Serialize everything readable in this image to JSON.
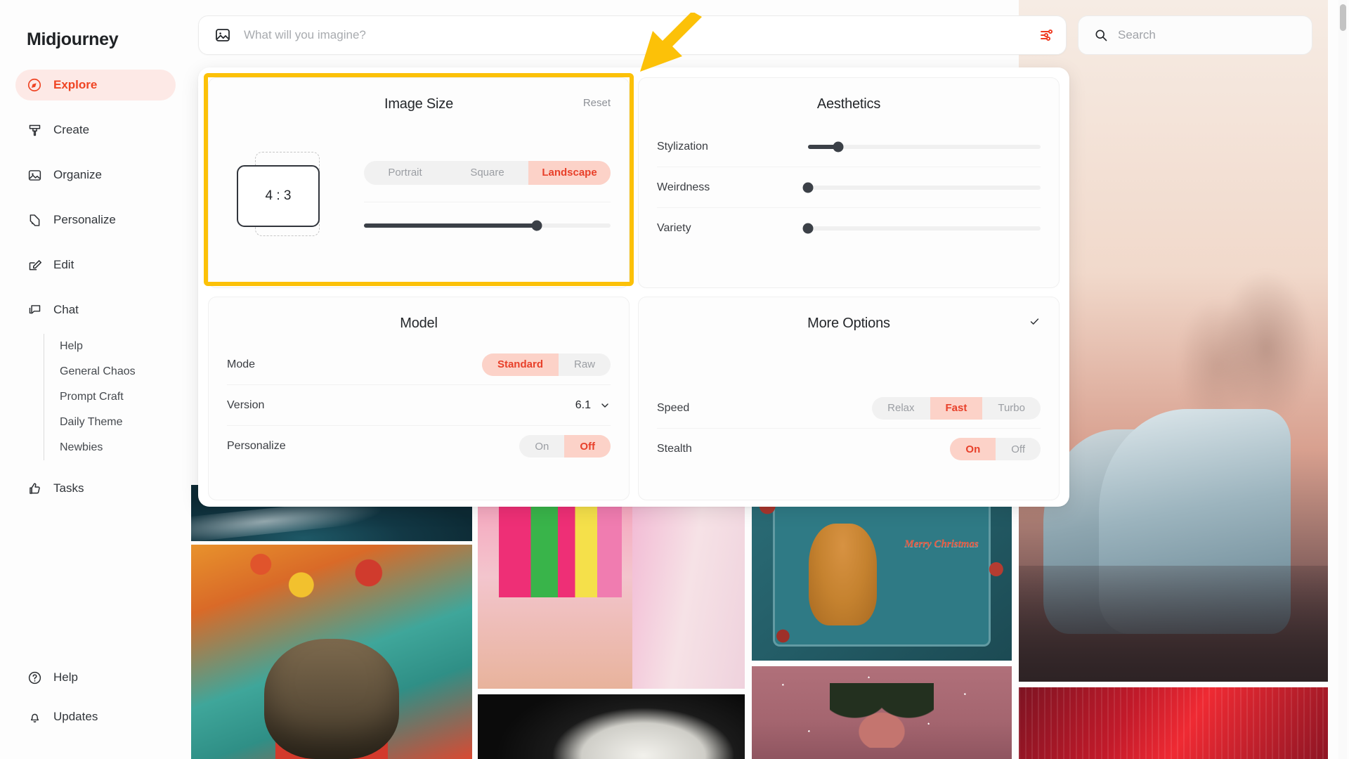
{
  "brand": "Midjourney",
  "sidebar": {
    "items": [
      {
        "label": "Explore",
        "icon": "compass-icon",
        "active": true
      },
      {
        "label": "Create",
        "icon": "brush-icon",
        "active": false
      },
      {
        "label": "Organize",
        "icon": "image-icon",
        "active": false
      },
      {
        "label": "Personalize",
        "icon": "palette-icon",
        "active": false
      },
      {
        "label": "Edit",
        "icon": "pencil-square-icon",
        "active": false
      },
      {
        "label": "Chat",
        "icon": "chat-bubble-icon",
        "active": false
      }
    ],
    "chat_subitems": [
      {
        "label": "Help"
      },
      {
        "label": "General Chaos"
      },
      {
        "label": "Prompt Craft"
      },
      {
        "label": "Daily Theme"
      },
      {
        "label": "Newbies"
      }
    ],
    "tasks": {
      "label": "Tasks",
      "icon": "thumbs-up-icon"
    },
    "bottom": [
      {
        "label": "Help",
        "icon": "question-circle-icon"
      },
      {
        "label": "Updates",
        "icon": "bell-icon"
      }
    ]
  },
  "topbar": {
    "prompt": {
      "value": "",
      "placeholder": "What will you imagine?",
      "icon": "image-icon"
    },
    "settings_icon": "sliders-icon",
    "search": {
      "value": "",
      "placeholder": "Search",
      "icon": "search-icon"
    }
  },
  "panels": {
    "image_size": {
      "title": "Image Size",
      "reset_label": "Reset",
      "ratio_value": "4 : 3",
      "orientation_options": [
        "Portrait",
        "Square",
        "Landscape"
      ],
      "orientation_selected": "Landscape",
      "size_slider_percent": 70
    },
    "aesthetics": {
      "title": "Aesthetics",
      "rows": [
        {
          "label": "Stylization",
          "percent": 13
        },
        {
          "label": "Weirdness",
          "percent": 0
        },
        {
          "label": "Variety",
          "percent": 0
        }
      ]
    },
    "model": {
      "title": "Model",
      "mode": {
        "label": "Mode",
        "options": [
          "Standard",
          "Raw"
        ],
        "selected": "Standard"
      },
      "version": {
        "label": "Version",
        "value": "6.1",
        "chevron": "chevron-down-icon"
      },
      "personalize": {
        "label": "Personalize",
        "options": [
          "On",
          "Off"
        ],
        "selected": "Off"
      }
    },
    "more_options": {
      "title": "More Options",
      "check_icon": "check-icon",
      "speed": {
        "label": "Speed",
        "options": [
          "Relax",
          "Fast",
          "Turbo"
        ],
        "selected": "Fast"
      },
      "stealth": {
        "label": "Stealth",
        "options": [
          "On",
          "Off"
        ],
        "selected": "On"
      }
    }
  },
  "annotation": {
    "highlight_target": "image-size-panel",
    "arrow_direction": "down-left",
    "color": "#fcc108"
  },
  "gallery": {
    "items": [
      {
        "name": "ocean-wave"
      },
      {
        "name": "floral-cat-collage"
      },
      {
        "name": "pink-corridor"
      },
      {
        "name": "dark-helmet"
      },
      {
        "name": "gingerbread-merry-christmas",
        "text": "Merry Christmas"
      },
      {
        "name": "reindeer-silhouette"
      },
      {
        "name": "two-wolves-fog"
      },
      {
        "name": "red-cyber-portrait"
      }
    ]
  },
  "colors": {
    "accent": "#ef4423",
    "accent_soft": "#fcd2c8",
    "highlight": "#fcc108",
    "text": "#24272b",
    "muted": "#9b9ea3"
  }
}
